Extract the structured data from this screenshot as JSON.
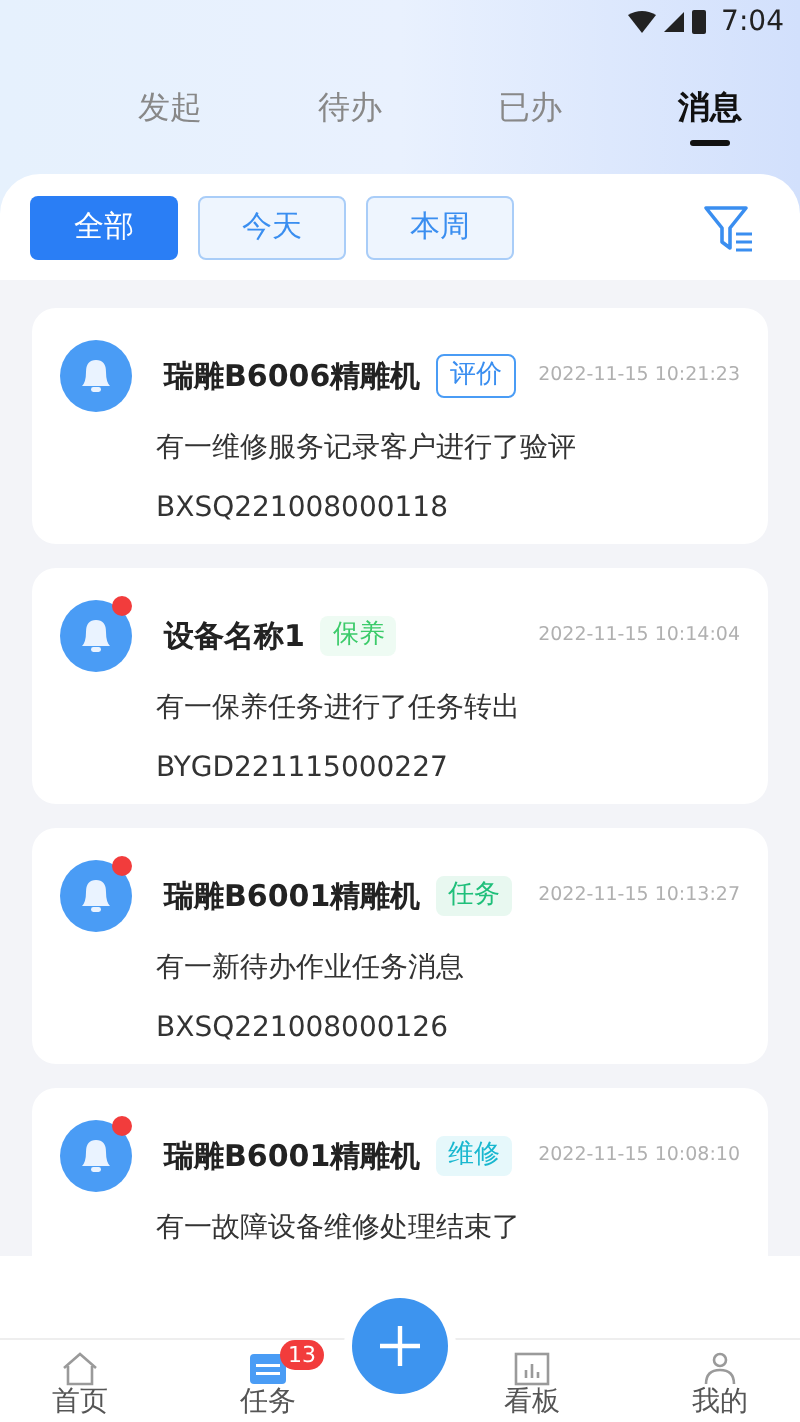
{
  "status_bar": {
    "time": "7:04"
  },
  "tabs": [
    {
      "label": "发起",
      "selected": false
    },
    {
      "label": "待办",
      "selected": false
    },
    {
      "label": "已办",
      "selected": false
    },
    {
      "label": "消息",
      "selected": true
    }
  ],
  "filters": [
    {
      "label": "全部",
      "selected": true
    },
    {
      "label": "今天",
      "selected": false
    },
    {
      "label": "本周",
      "selected": false
    }
  ],
  "messages": [
    {
      "title": "瑞雕B6006精雕机",
      "tag": "评价",
      "kind": "evaluate",
      "time": "2022-11-15 10:21:23",
      "text": "有一维修服务记录客户进行了验评",
      "code": "BXSQ221008000118",
      "unread": false
    },
    {
      "title": "设备名称1",
      "tag": "保养",
      "kind": "maintain",
      "time": "2022-11-15 10:14:04",
      "text": "有一保养任务进行了任务转出",
      "code": "BYGD221115000227",
      "unread": true
    },
    {
      "title": "瑞雕B6001精雕机",
      "tag": "任务",
      "kind": "task",
      "time": "2022-11-15 10:13:27",
      "text": "有一新待办作业任务消息",
      "code": "BXSQ221008000126",
      "unread": true
    },
    {
      "title": "瑞雕B6001精雕机",
      "tag": "维修",
      "kind": "repair",
      "time": "2022-11-15 10:08:10",
      "text": "有一故障设备维修处理结束了",
      "unread": true
    }
  ],
  "nav": [
    {
      "label": "首页",
      "kind": "home",
      "selected": false
    },
    {
      "label": "任务",
      "kind": "task",
      "selected": true,
      "badge": "13"
    },
    {
      "label": "看板",
      "kind": "board",
      "selected": false
    },
    {
      "label": "我的",
      "kind": "me",
      "selected": false
    }
  ]
}
